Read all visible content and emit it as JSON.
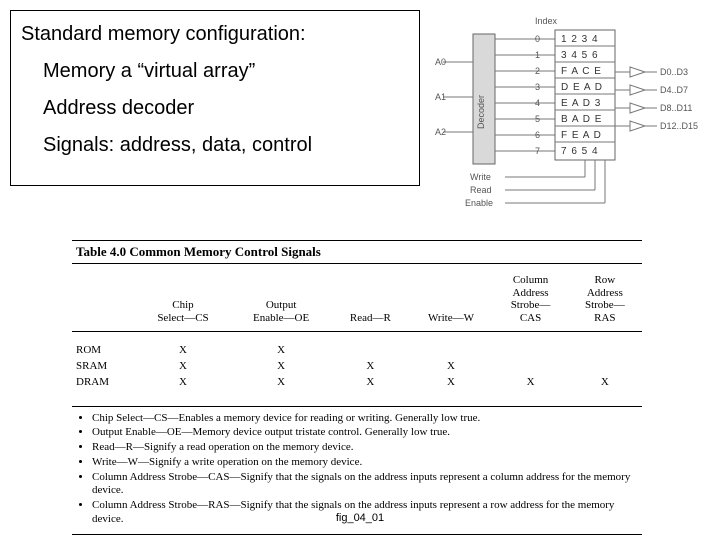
{
  "textbox": {
    "title": "Standard memory configuration:",
    "b1": "Memory a “virtual array”",
    "b2": "Address decoder",
    "b3": "Signals: address, data, control"
  },
  "diagram": {
    "index_label": "Index",
    "decoder_label": "Decoder",
    "addr": {
      "a0": "A0",
      "a1": "A1",
      "a2": "A2"
    },
    "idx": {
      "i0": "0",
      "i1": "1",
      "i2": "2",
      "i3": "3",
      "i4": "4",
      "i5": "5",
      "i6": "6",
      "i7": "7"
    },
    "rows": {
      "r0": "1 2 3 4",
      "r1": "3 4 5 6",
      "r2": "F A C E",
      "r3": "D E A D",
      "r4": "E A D 3",
      "r5": "B A D E",
      "r6": "F E A D",
      "r7": "7 6 5 4"
    },
    "dout": {
      "d0": "D0..D3",
      "d1": "D4..D7",
      "d2": "D8..D11",
      "d3": "D12..D15"
    },
    "ctrl": {
      "write": "Write",
      "read": "Read",
      "enable": "Enable"
    }
  },
  "table": {
    "title": "Table 4.0   Common Memory Control Signals",
    "headers": {
      "blank": "",
      "cs": "Chip\nSelect—CS",
      "oe": "Output\nEnable—OE",
      "r": "Read—R",
      "w": "Write—W",
      "cas": "Column\nAddress\nStrobe—\nCAS",
      "ras": "Row\nAddress\nStrobe—\nRAS"
    },
    "rows": [
      {
        "label": "ROM",
        "cs": "X",
        "oe": "X",
        "r": "",
        "w": "",
        "cas": "",
        "ras": ""
      },
      {
        "label": "SRAM",
        "cs": "X",
        "oe": "X",
        "r": "X",
        "w": "X",
        "cas": "",
        "ras": ""
      },
      {
        "label": "DRAM",
        "cs": "X",
        "oe": "X",
        "r": "X",
        "w": "X",
        "cas": "X",
        "ras": "X"
      }
    ],
    "notes": {
      "n0": "Chip Select—CS—Enables a memory device for reading or writing. Generally low true.",
      "n1": "Output Enable—OE—Memory device output tristate control. Generally low true.",
      "n2": "Read—R—Signify a read operation on the memory device.",
      "n3": "Write—W—Signify a write operation on the memory device.",
      "n4": "Column Address Strobe—CAS—Signify that the signals on the address inputs represent a column address for the memory device.",
      "n5": "Column Address Strobe—RAS—Signify that the signals on the address inputs represent a row address for the memory device."
    }
  },
  "caption": "fig_04_01"
}
